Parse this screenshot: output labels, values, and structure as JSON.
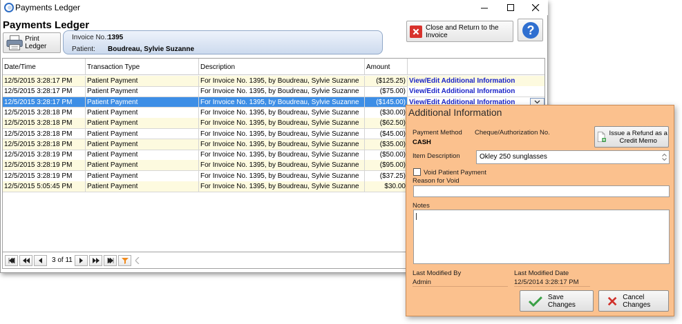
{
  "window": {
    "title": "Payments Ledger"
  },
  "header": {
    "title": "Payments Ledger",
    "print_label": "Print Ledger",
    "invoice_label": "Invoice No.:",
    "invoice_value": "1395",
    "patient_label": "Patient:",
    "patient_value": "Boudreau, Sylvie Suzanne",
    "close_return_label": "Close and Return to the Invoice"
  },
  "grid": {
    "columns": [
      "Date/Time",
      "Transaction Type",
      "Description",
      "Amount"
    ],
    "link_label": "View/Edit Additional Information",
    "rows": [
      {
        "date": "12/5/2015 3:28:17 PM",
        "type": "Patient Payment",
        "desc": "For Invoice No. 1395, by Boudreau, Sylvie Suzanne",
        "amount": "($125.25)"
      },
      {
        "date": "12/5/2015 3:28:17 PM",
        "type": "Patient Payment",
        "desc": "For Invoice No. 1395, by Boudreau, Sylvie Suzanne",
        "amount": "($75.00)"
      },
      {
        "date": "12/5/2015 3:28:17 PM",
        "type": "Patient Payment",
        "desc": "For Invoice No. 1395, by Boudreau, Sylvie Suzanne",
        "amount": "($145.00)"
      },
      {
        "date": "12/5/2015 3:28:18 PM",
        "type": "Patient Payment",
        "desc": "For Invoice No. 1395, by Boudreau, Sylvie Suzanne",
        "amount": "($30.00)"
      },
      {
        "date": "12/5/2015 3:28:18 PM",
        "type": "Patient Payment",
        "desc": "For Invoice No. 1395, by Boudreau, Sylvie Suzanne",
        "amount": "($62.50)"
      },
      {
        "date": "12/5/2015 3:28:18 PM",
        "type": "Patient Payment",
        "desc": "For Invoice No. 1395, by Boudreau, Sylvie Suzanne",
        "amount": "($45.00)"
      },
      {
        "date": "12/5/2015 3:28:18 PM",
        "type": "Patient Payment",
        "desc": "For Invoice No. 1395, by Boudreau, Sylvie Suzanne",
        "amount": "($35.00)"
      },
      {
        "date": "12/5/2015 3:28:19 PM",
        "type": "Patient Payment",
        "desc": "For Invoice No. 1395, by Boudreau, Sylvie Suzanne",
        "amount": "($50.00)"
      },
      {
        "date": "12/5/2015 3:28:19 PM",
        "type": "Patient Payment",
        "desc": "For Invoice No. 1395, by Boudreau, Sylvie Suzanne",
        "amount": "($95.00)"
      },
      {
        "date": "12/5/2015 3:28:19 PM",
        "type": "Patient Payment",
        "desc": "For Invoice No. 1395, by Boudreau, Sylvie Suzanne",
        "amount": "($37.25)"
      },
      {
        "date": "12/5/2015 5:05:45 PM",
        "type": "Patient Payment",
        "desc": "For Invoice No. 1395, by Boudreau, Sylvie Suzanne",
        "amount": "$30.00"
      }
    ]
  },
  "pager": {
    "position_text": "3 of 11"
  },
  "popup": {
    "title": "Additional Information",
    "payment_method_label": "Payment Method",
    "payment_method_value": "CASH",
    "cheque_label": "Cheque/Authorization No.",
    "refund_label": "Issue a Refund as a Credit Memo",
    "item_desc_label": "Item Description",
    "item_desc_value": "Okley 250 sunglasses",
    "void_label": "Void Patient Payment",
    "reason_label": "Reason for Void",
    "reason_value": "",
    "notes_label": "Notes",
    "notes_value": "",
    "modified_by_label": "Last Modified By",
    "modified_by_value": "Admin",
    "modified_date_label": "Last Modified Date",
    "modified_date_value": "12/5/2014 3:28:17 PM",
    "save_label": "Save Changes",
    "cancel_label": "Cancel Changes"
  },
  "colors": {
    "row_alt": "#fdfadf",
    "row_selected": "#3d8ee6",
    "link": "#1a24c8",
    "popup_bg": "#fbc18e",
    "help_blue": "#2f6fd0"
  }
}
